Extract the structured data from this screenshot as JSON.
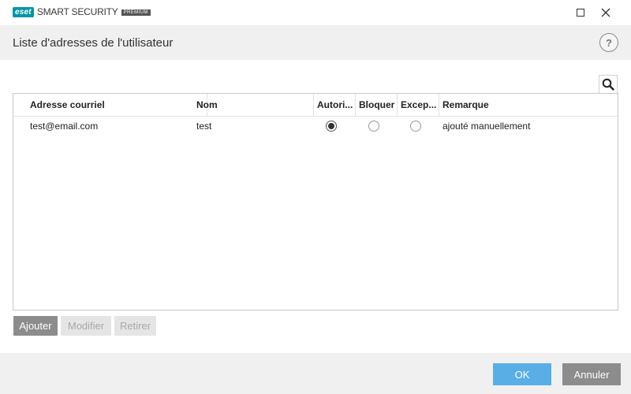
{
  "window": {
    "brand_badge": "eset",
    "product_name": "SMART SECURITY",
    "edition": "PREMIUM",
    "controls": [
      "maximize-icon",
      "close-icon"
    ]
  },
  "header": {
    "title": "Liste d'adresses de l'utilisateur",
    "help_label": "?"
  },
  "search": {
    "icon": "search-icon"
  },
  "table": {
    "columns": {
      "address": "Adresse courriel",
      "name": "Nom",
      "allow": "Autori...",
      "block": "Bloquer",
      "exception": "Excep...",
      "note": "Remarque"
    },
    "rows": [
      {
        "address": "test@email.com",
        "name": "test",
        "selected": "allow",
        "note": "ajouté manuellement"
      }
    ]
  },
  "actions": {
    "add": "Ajouter",
    "edit": "Modifier",
    "remove": "Retirer"
  },
  "footer": {
    "ok": "OK",
    "cancel": "Annuler"
  },
  "colors": {
    "brand": "#0096a6",
    "primary_button": "#5aaee6",
    "secondary_button": "#8c8c8c"
  }
}
